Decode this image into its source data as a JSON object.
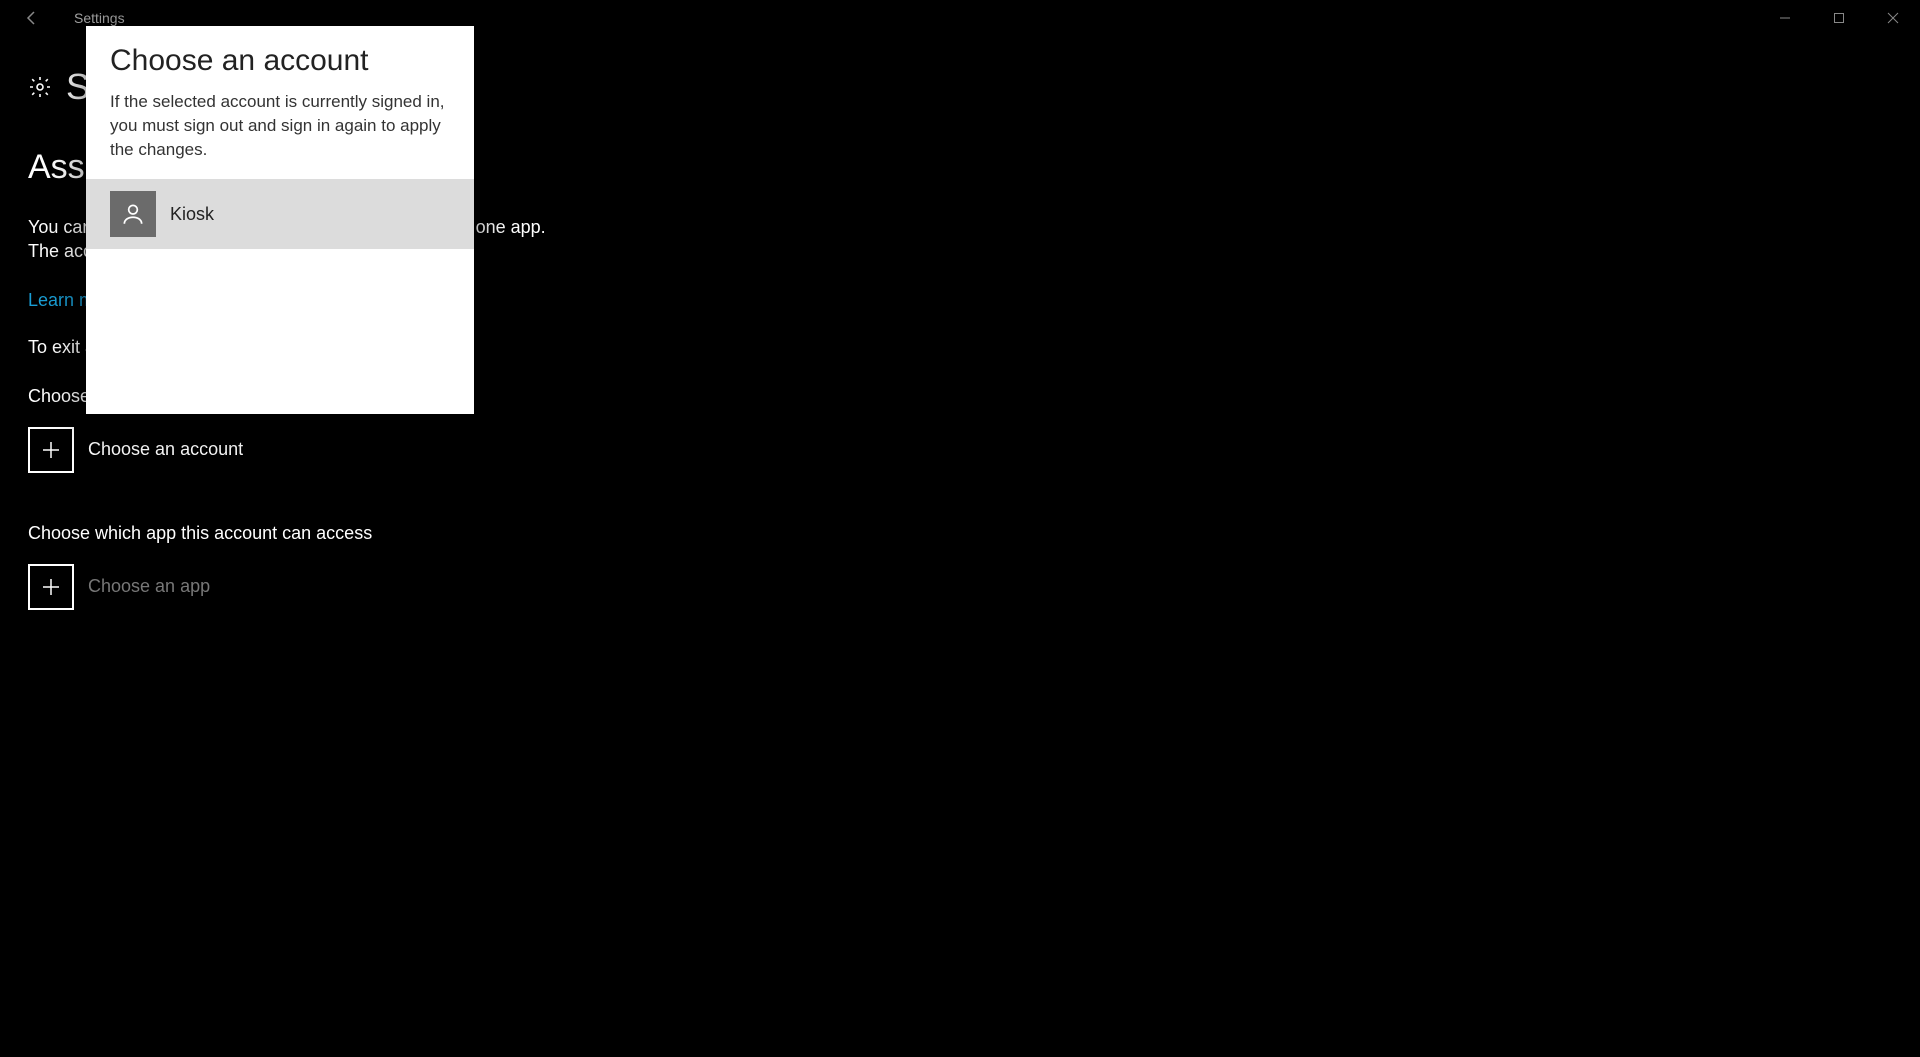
{
  "window": {
    "title": "Settings"
  },
  "page": {
    "home_label_prefix": "S",
    "title_partial": "Assig",
    "description": "You can restrict an account so that it only has access to one app. The account is able to work pr",
    "learn_more": "Learn m",
    "exit_text": "To exit a",
    "choose_label": "Choose",
    "choose_account": "Choose an account",
    "choose_app_label": "Choose which app this account can access",
    "choose_app": "Choose an app"
  },
  "dialog": {
    "title": "Choose an account",
    "body": "If the selected account is currently signed in, you must sign out and sign in again to apply the changes.",
    "accounts": [
      {
        "name": "Kiosk"
      }
    ]
  }
}
